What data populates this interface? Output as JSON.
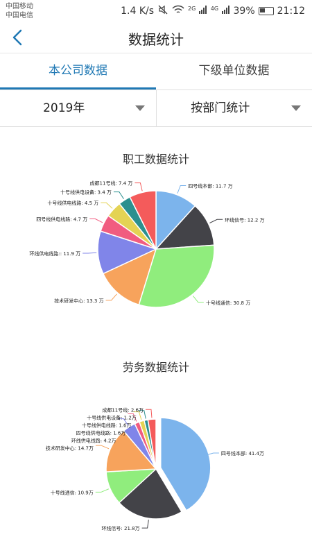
{
  "status_bar": {
    "carrier_1": "中国移动",
    "carrier_2": "中国电信",
    "speed": "1.4 K/s",
    "network_2g": "2G",
    "network_4g": "4G",
    "battery": "39%",
    "time": "21:12"
  },
  "header": {
    "title": "数据统计"
  },
  "tabs": [
    {
      "label": "本公司数据",
      "active": true
    },
    {
      "label": "下级单位数据",
      "active": false
    }
  ],
  "filters": {
    "year": "2019年",
    "group_by": "按部门统计"
  },
  "colors": {
    "accent": "#1f78b4"
  },
  "chart_data": [
    {
      "type": "pie",
      "title": "职工数据统计",
      "slices": [
        {
          "label": "四号线本部: 11.7 万",
          "value": 11.7,
          "color": "#7cb4ec"
        },
        {
          "label": "环线信号: 12.2 万",
          "value": 12.2,
          "color": "#434348"
        },
        {
          "label": "十号线通信: 30.8 万",
          "value": 30.8,
          "color": "#90ed7d"
        },
        {
          "label": "技术研发中心: 13.3 万",
          "value": 13.3,
          "color": "#f7a35c"
        },
        {
          "label": "环线供电线路:: 11.9 万",
          "value": 11.9,
          "color": "#8085e9"
        },
        {
          "label": "四号线供电线路: 4.7 万",
          "value": 4.7,
          "color": "#f15c80"
        },
        {
          "label": "十号线供电线路: 4.5 万",
          "value": 4.5,
          "color": "#e4d354"
        },
        {
          "label": "十号线供电设备: 3.4 万",
          "value": 3.4,
          "color": "#2b908f"
        },
        {
          "label": "成都11号线: 7.4 万",
          "value": 7.4,
          "color": "#f45b5b"
        }
      ]
    },
    {
      "type": "pie",
      "title": "劳务数据统计",
      "slices": [
        {
          "label": "四号线本部: 41.4万",
          "value": 41.4,
          "color": "#7cb4ec"
        },
        {
          "label": "环线信号: 21.8万",
          "value": 21.8,
          "color": "#434348"
        },
        {
          "label": "十号线通信: 10.9万",
          "value": 10.9,
          "color": "#90ed7d"
        },
        {
          "label": "技术研发中心: 14.7万",
          "value": 14.7,
          "color": "#f7a35c"
        },
        {
          "label": "环线供电线路: 4.2万",
          "value": 4.2,
          "color": "#8085e9"
        },
        {
          "label": "四号线供电线路: 1.6万",
          "value": 1.6,
          "color": "#f15c80"
        },
        {
          "label": "十号线供电线路: 1.6万",
          "value": 1.6,
          "color": "#e4d354"
        },
        {
          "label": "十号线供电设备: 1.2万",
          "value": 1.2,
          "color": "#2b908f"
        },
        {
          "label": "成都11号线: 2.6万",
          "value": 2.6,
          "color": "#f45b5b"
        }
      ]
    }
  ]
}
